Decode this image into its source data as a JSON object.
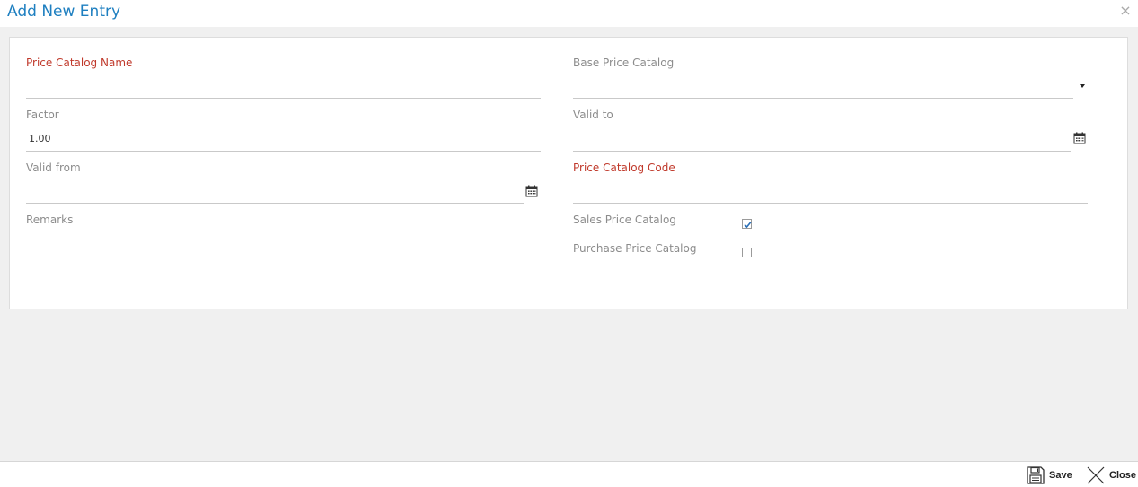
{
  "dialog": {
    "title": "Add New Entry",
    "close_glyph": "×"
  },
  "form": {
    "price_catalog_name": {
      "label": "Price Catalog Name",
      "value": ""
    },
    "base_price_catalog": {
      "label": "Base Price Catalog",
      "value": ""
    },
    "factor": {
      "label": "Factor",
      "value": "1.00"
    },
    "valid_to": {
      "label": "Valid to",
      "value": ""
    },
    "valid_from": {
      "label": "Valid from",
      "value": ""
    },
    "price_catalog_code": {
      "label": "Price Catalog Code",
      "value": ""
    },
    "remarks": {
      "label": "Remarks",
      "value": ""
    },
    "sales_price_catalog": {
      "label": "Sales Price Catalog",
      "checked": true
    },
    "purchase_price_catalog": {
      "label": "Purchase Price Catalog",
      "checked": false
    }
  },
  "footer": {
    "save_label": "Save",
    "close_label": "Close"
  },
  "colors": {
    "title": "#1e7fc0",
    "required_label": "#c0392b",
    "label": "#8c8c8c",
    "checkmark": "#2b6fb6"
  },
  "icons": {
    "calendar": "calendar-icon",
    "dropdown": "caret-down-icon",
    "save": "floppy-disk-icon",
    "close": "x-icon"
  }
}
